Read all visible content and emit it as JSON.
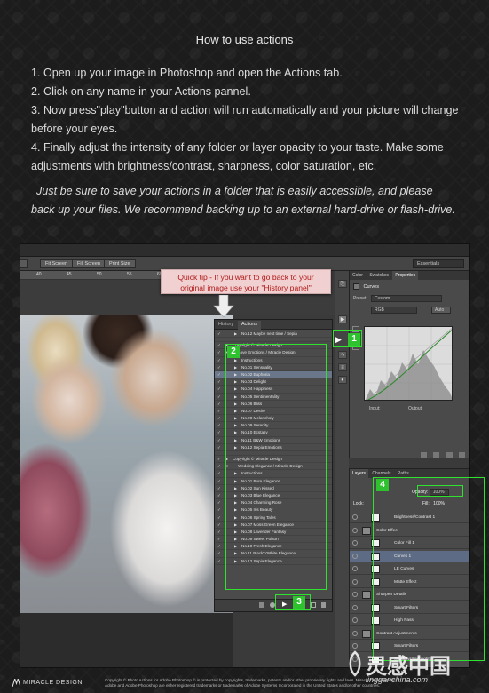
{
  "title": "How to use actions",
  "steps": [
    "1. Open up your image in Photoshop and open the Actions tab.",
    "2. Click on any name in your Actions pannel.",
    "3. Now press\"play\"button and action will run automatically and your picture will change before your eyes.",
    "4. Finally adjust the intensity of any folder or layer opacity to your taste. Make some adjustments with brightness/contrast, sharpness, color saturation, etc."
  ],
  "note": "Just be sure to save your actions in a folder that is easily accessible, and please back up your files. We recommend backing up to an external hard-drive or flash-drive.",
  "ps": {
    "options_buttons": [
      "Fit Screen",
      "Fill Screen",
      "Print Size"
    ],
    "workspace": "Essentials",
    "ruler_ticks": [
      "40",
      "45",
      "50",
      "55",
      "60",
      "65",
      "70"
    ],
    "panel_tabs": [
      "History",
      "Actions"
    ],
    "actions": [
      {
        "label": "No.12 Maybe next time / Sepia",
        "indent": 2
      },
      {
        "label": "",
        "gap": true
      },
      {
        "label": "Copyright © Miracle Design",
        "indent": 1
      },
      {
        "label": "Love Emotions / Miracle Design",
        "indent": 1,
        "folder": true
      },
      {
        "label": "Instructions",
        "indent": 2
      },
      {
        "label": "No.01 Sensuality",
        "indent": 2
      },
      {
        "label": "No.02 Euphoria",
        "indent": 2,
        "selected": true
      },
      {
        "label": "No.03 Delight",
        "indent": 2
      },
      {
        "label": "No.04 Happiness",
        "indent": 2
      },
      {
        "label": "No.05 Sentimentality",
        "indent": 2
      },
      {
        "label": "No.06 Bliss",
        "indent": 2
      },
      {
        "label": "No.07 Desire",
        "indent": 2
      },
      {
        "label": "No.08 Melancholy",
        "indent": 2
      },
      {
        "label": "No.09 Serenity",
        "indent": 2
      },
      {
        "label": "No.10 Ecstasy",
        "indent": 2
      },
      {
        "label": "No.11 B&W Emotions",
        "indent": 2
      },
      {
        "label": "No.12 Sepia Emotions",
        "indent": 2
      },
      {
        "label": "",
        "gap": true
      },
      {
        "label": "Copyright © Miracle Design",
        "indent": 1
      },
      {
        "label": "Wedding Elegance / Miracle Design",
        "indent": 1,
        "folder": true
      },
      {
        "label": "Instructions",
        "indent": 2
      },
      {
        "label": "No.01 Pure Elegance",
        "indent": 2
      },
      {
        "label": "No.02 Sun Kissed",
        "indent": 2
      },
      {
        "label": "No.03 Blue Elegance",
        "indent": 2
      },
      {
        "label": "No.04 Charming Rose",
        "indent": 2
      },
      {
        "label": "No.05 Iris Beauty",
        "indent": 2
      },
      {
        "label": "No.06 Spring Tales",
        "indent": 2
      },
      {
        "label": "No.07 Moss Green Elegance",
        "indent": 2
      },
      {
        "label": "No.08 Lavender Fantasy",
        "indent": 2
      },
      {
        "label": "No.09 Sweet Poison",
        "indent": 2
      },
      {
        "label": "No.10 Fresh Elegance",
        "indent": 2
      },
      {
        "label": "No.11 Black'n'White Elegance",
        "indent": 2
      },
      {
        "label": "No.12 Sepia Elegance",
        "indent": 2
      }
    ],
    "props_tabs": [
      "Color",
      "Swatches",
      "Properties"
    ],
    "curves_title": "Curves",
    "preset_label": "Preset:",
    "preset_value": "Custom",
    "channel_value": "RGB",
    "auto_label": "Auto",
    "input_label": "Input:",
    "output_label": "Output:",
    "layers_tabs": [
      "Layers",
      "Channels",
      "Paths"
    ],
    "opacity_label": "Opacity:",
    "opacity_value": "100%",
    "fill_label": "Fill:",
    "fill_value": "100%",
    "lock_label": "Lock:",
    "layers": [
      {
        "label": "Brightness/Contrast 1"
      },
      {
        "label": "Color Effect",
        "folder": true
      },
      {
        "label": "Color Fill 1"
      },
      {
        "label": "Curves 1",
        "selected": true
      },
      {
        "label": "LE Curves"
      },
      {
        "label": "Matte Effect"
      },
      {
        "label": "Sharpen Details",
        "folder": true
      },
      {
        "label": "Smart Filters"
      },
      {
        "label": "High Pass"
      },
      {
        "label": "Contrast Adjustments",
        "folder": true
      },
      {
        "label": "Smart Filters"
      },
      {
        "label": "Shadows/Highlights"
      }
    ]
  },
  "tip": {
    "line1": "Quick tip - If you want to go back to your",
    "line2": "original image use your \"History panel\""
  },
  "badges": [
    "1",
    "2",
    "3",
    "4"
  ],
  "footer": {
    "logo": "MIRACLE DESIGN",
    "copy1": "Copyright © Photo Actions for Adobe Photoshop © is protected by copyrights, trademarks, patents and/or other proprietary rights and laws. Miracle Design Studio",
    "copy2": "Adobe and Adobe Photoshop are either registered trademarks or trademarks of Adobe Systems Incorporated in the United States and/or other countries."
  },
  "watermark": {
    "main": "灵感中国",
    "sub": "lingganchina.com"
  },
  "colors": {
    "green": "#2ee22e",
    "tip_text": "#b01818",
    "tip_bg": "#f0d0d0"
  }
}
